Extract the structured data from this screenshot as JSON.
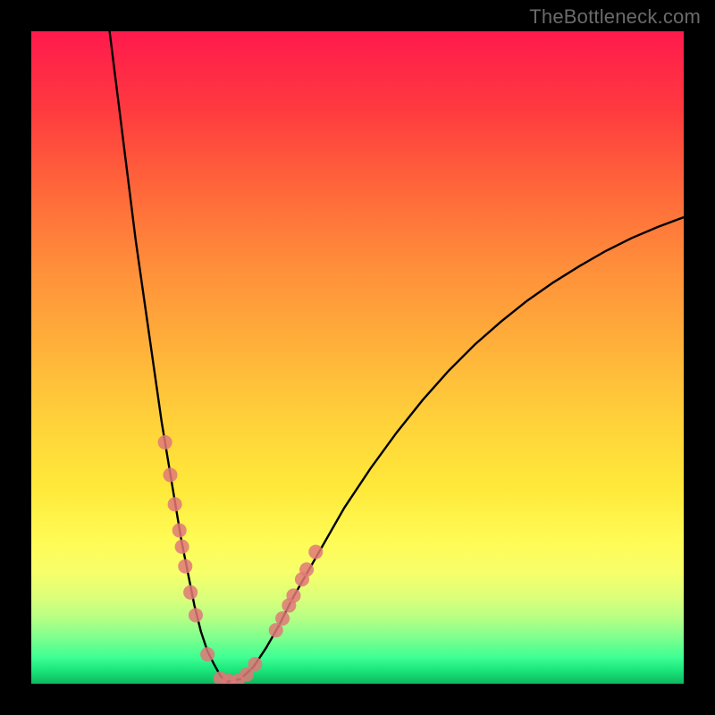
{
  "watermark": "TheBottleneck.com",
  "chart_data": {
    "type": "line",
    "title": "",
    "xlabel": "",
    "ylabel": "",
    "xlim": [
      0,
      100
    ],
    "ylim": [
      0,
      100
    ],
    "grid": false,
    "legend": false,
    "background_gradient": [
      "#ff1a4d",
      "#ff6a3a",
      "#ffd23a",
      "#fffb55",
      "#7dff8e",
      "#0fb75f"
    ],
    "series": [
      {
        "name": "bottleneck-curve",
        "x": [
          12,
          13,
          14,
          15,
          16,
          17,
          18,
          19,
          20,
          21,
          22,
          23,
          24,
          25,
          26,
          27,
          28,
          29,
          30,
          32,
          34,
          36,
          38,
          40,
          44,
          48,
          52,
          56,
          60,
          64,
          68,
          72,
          76,
          80,
          84,
          88,
          92,
          96,
          100
        ],
        "y": [
          100,
          92,
          84,
          76,
          68,
          61,
          54,
          47,
          40,
          34,
          28,
          22,
          17,
          12,
          8,
          5,
          3,
          1.2,
          0.3,
          0.7,
          2.5,
          5.5,
          9,
          13,
          20,
          27,
          33,
          38.5,
          43.5,
          48,
          52,
          55.5,
          58.7,
          61.5,
          64,
          66.3,
          68.3,
          70,
          71.5
        ],
        "color": "#000000"
      }
    ],
    "markers": {
      "name": "highlight-points",
      "color": "#e07878",
      "radius_pct": 1.1,
      "points": [
        {
          "x": 20.5,
          "y": 37
        },
        {
          "x": 21.3,
          "y": 32
        },
        {
          "x": 22.0,
          "y": 27.5
        },
        {
          "x": 22.7,
          "y": 23.5
        },
        {
          "x": 23.1,
          "y": 21
        },
        {
          "x": 23.6,
          "y": 18
        },
        {
          "x": 24.4,
          "y": 14
        },
        {
          "x": 25.2,
          "y": 10.5
        },
        {
          "x": 27.0,
          "y": 4.5
        },
        {
          "x": 29.0,
          "y": 0.8
        },
        {
          "x": 30.3,
          "y": 0.4
        },
        {
          "x": 31.6,
          "y": 0.4
        },
        {
          "x": 33.0,
          "y": 1.4
        },
        {
          "x": 34.3,
          "y": 3.0
        },
        {
          "x": 37.5,
          "y": 8.2
        },
        {
          "x": 38.5,
          "y": 10.0
        },
        {
          "x": 39.5,
          "y": 12.0
        },
        {
          "x": 40.2,
          "y": 13.5
        },
        {
          "x": 41.5,
          "y": 16.0
        },
        {
          "x": 42.2,
          "y": 17.5
        },
        {
          "x": 43.6,
          "y": 20.2
        }
      ]
    }
  }
}
